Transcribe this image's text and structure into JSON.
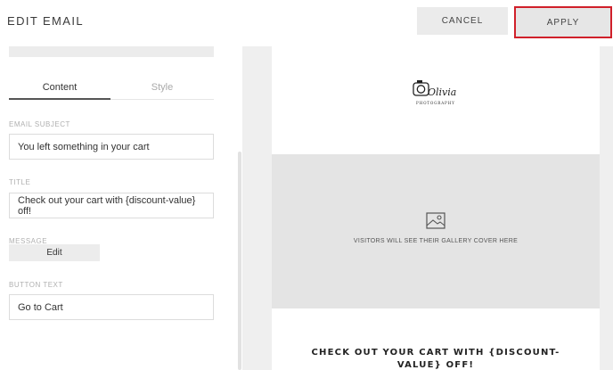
{
  "header": {
    "title": "EDIT EMAIL",
    "cancel_label": "CANCEL",
    "apply_label": "APPLY"
  },
  "tabs": [
    {
      "label": "Content",
      "active": true
    },
    {
      "label": "Style",
      "active": false
    }
  ],
  "form": {
    "email_subject_label": "EMAIL SUBJECT",
    "email_subject_value": "You left something in your cart",
    "title_label": "TITLE",
    "title_value": "Check out your cart with {discount-value} off!",
    "message_label": "MESSAGE",
    "message_edit_label": "Edit",
    "button_text_label": "BUTTON TEXT",
    "button_text_value": "Go to Cart"
  },
  "preview": {
    "logo_name": "Olivia",
    "logo_sub": "PHOTOGRAPHY",
    "cover_placeholder": "VISITORS WILL SEE THEIR GALLERY COVER HERE",
    "headline": "CHECK OUT YOUR CART WITH {DISCOUNT-VALUE} OFF!"
  },
  "colors": {
    "apply_highlight": "#d0202a",
    "cover_bg": "#e4e4e4",
    "preview_bg": "#efefef"
  },
  "icons": {
    "cover": "image-placeholder-icon",
    "logo": "camera-logo-icon"
  }
}
